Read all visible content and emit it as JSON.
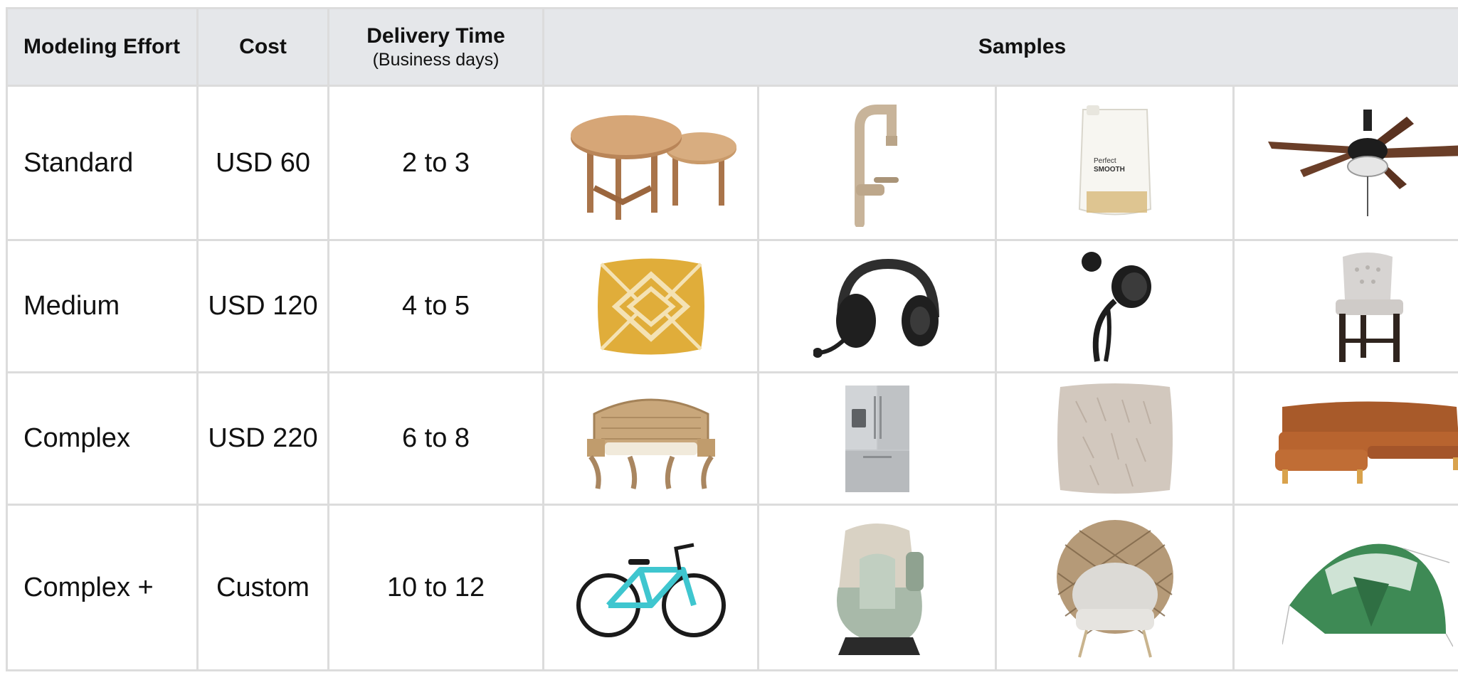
{
  "table": {
    "headers": {
      "effort": "Modeling Effort",
      "cost": "Cost",
      "delivery": "Delivery Time",
      "delivery_sub": "(Business days)",
      "samples": "Samples"
    },
    "rows": [
      {
        "effort": "Standard",
        "cost": "USD 60",
        "delivery": "2 to 3",
        "samples": [
          "nesting-tables-icon",
          "faucet-icon",
          "shampoo-pouch-icon",
          "ceiling-fan-icon"
        ]
      },
      {
        "effort": "Medium",
        "cost": "USD 120",
        "delivery": "4 to 5",
        "samples": [
          "cushion-icon",
          "headset-icon",
          "shower-head-icon",
          "bar-stool-icon"
        ]
      },
      {
        "effort": "Complex",
        "cost": "USD 220",
        "delivery": "6 to 8",
        "samples": [
          "wicker-bench-icon",
          "refrigerator-icon",
          "fur-pillow-icon",
          "sectional-sofa-icon"
        ]
      },
      {
        "effort": "Complex +",
        "cost": "Custom",
        "delivery": "10 to 12",
        "samples": [
          "bicycle-icon",
          "car-seat-icon",
          "egg-chair-icon",
          "tent-icon"
        ]
      }
    ]
  },
  "colors": {
    "header_bg": "#e5e7ea",
    "grid": "#dcdcdc"
  }
}
